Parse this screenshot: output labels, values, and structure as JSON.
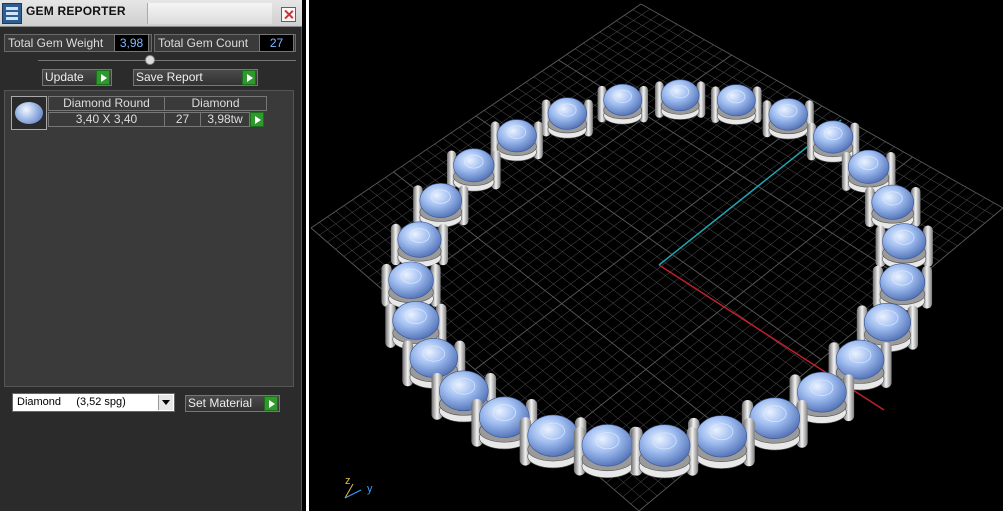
{
  "window": {
    "title": "GEM REPORTER"
  },
  "stats": {
    "weight_label": "Total Gem Weight",
    "weight_value": "3,98",
    "count_label": "Total Gem Count",
    "count_value": "27"
  },
  "buttons": {
    "update": "Update",
    "save_report": "Save Report",
    "set_material": "Set Material"
  },
  "gem_list": [
    {
      "shape": "Diamond Round",
      "size": "3,40 X 3,40",
      "material": "Diamond",
      "count": "27",
      "weight": "3,98tw"
    }
  ],
  "material_select": {
    "value": "Diamond     (3,52 spg)"
  },
  "viewport": {
    "axis_z": "z",
    "axis_y": "y",
    "colors": {
      "grid": "#5a5a5a",
      "x_axis": "#c0202a",
      "y_axis": "#1fa6b5",
      "gem": "#8fb4ec"
    }
  }
}
